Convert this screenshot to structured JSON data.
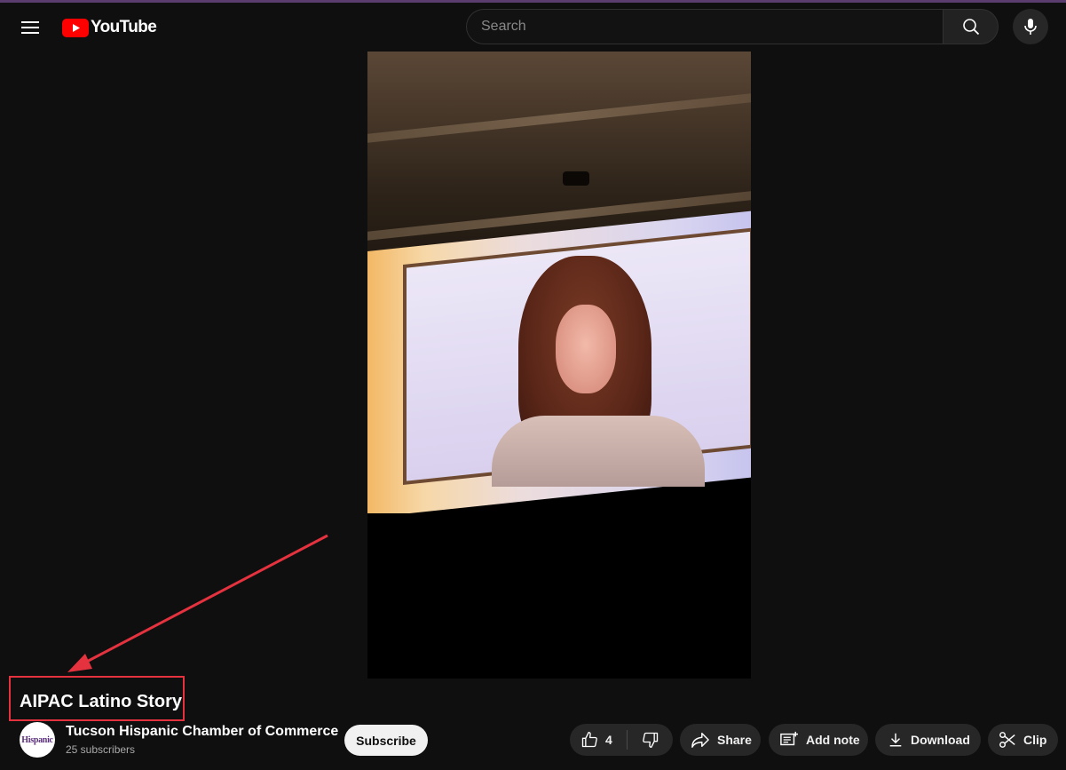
{
  "header": {
    "logo_text": "YouTube",
    "search_placeholder": "Search",
    "brand_color": "#ff0000"
  },
  "video": {
    "title": "AIPAC Latino Story"
  },
  "channel": {
    "name": "Tucson Hispanic Chamber of Commerce",
    "subscribers": "25 subscribers",
    "avatar_text": "Hispanic",
    "subscribe_label": "Subscribe"
  },
  "actions": {
    "like_count": "4",
    "share_label": "Share",
    "add_note_label": "Add note",
    "download_label": "Download",
    "clip_label": "Clip"
  },
  "annotation": {
    "highlight_color": "#e5323f"
  }
}
